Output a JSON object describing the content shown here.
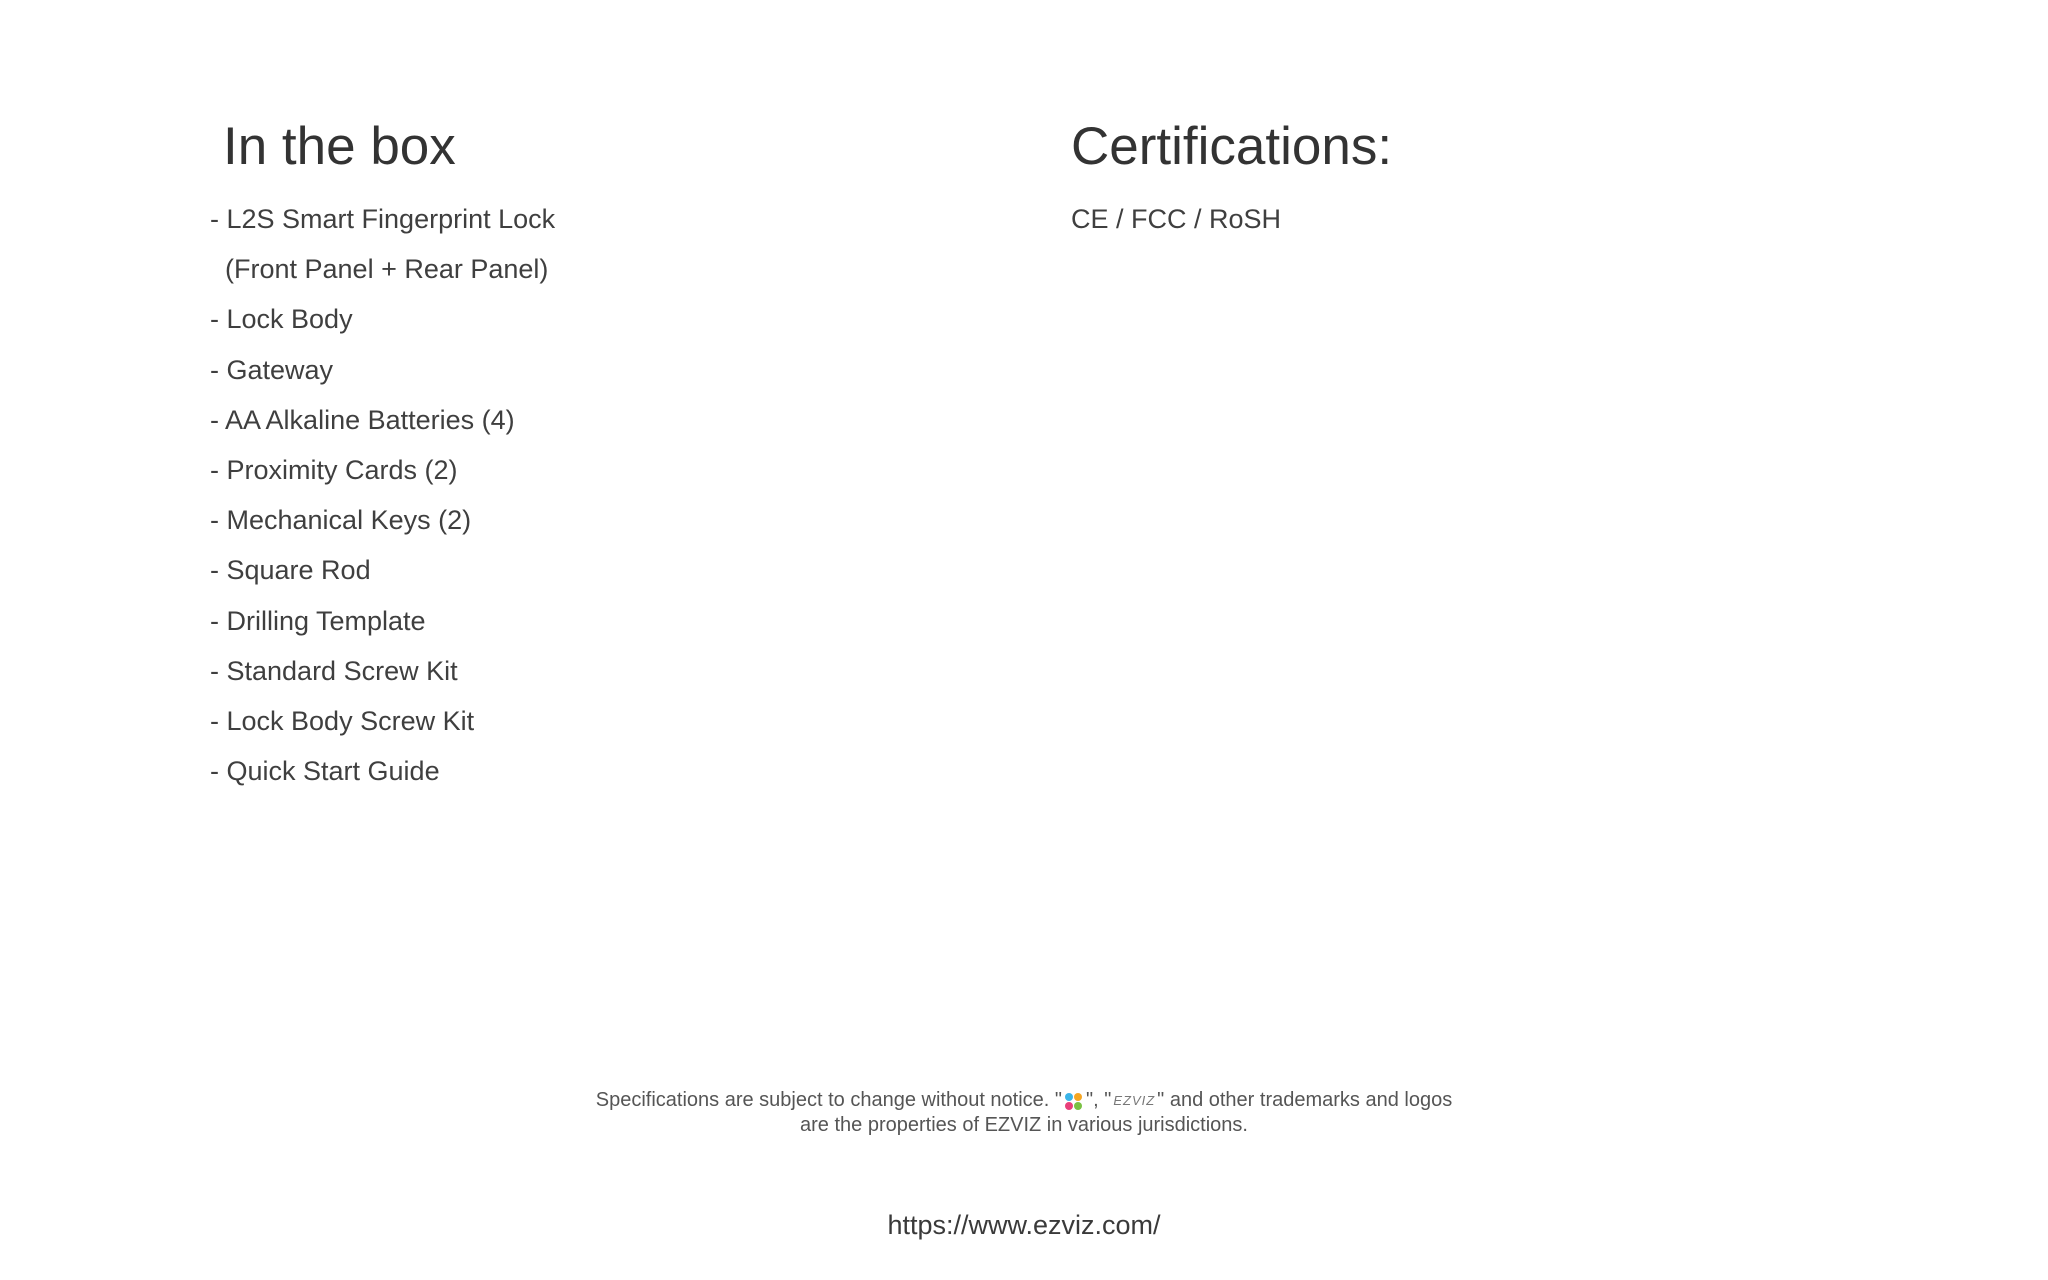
{
  "in_the_box": {
    "heading": "In the box",
    "items": [
      "- L2S Smart Fingerprint Lock",
      "  (Front Panel + Rear Panel)",
      "- Lock Body",
      "- Gateway",
      "- AA Alkaline Batteries (4)",
      "- Proximity Cards (2)",
      "- Mechanical Keys (2)",
      "- Square Rod",
      "- Drilling Template",
      "- Standard Screw Kit",
      "- Lock Body Screw Kit",
      "- Quick Start Guide"
    ]
  },
  "certifications": {
    "heading": "Certifications:",
    "text": "CE / FCC / RoSH"
  },
  "footer": {
    "notice_part1": "Specifications are subject to change without notice.  \"",
    "notice_part2": "\", \"",
    "wordmark": "EZVIZ",
    "notice_part3": "\" and other trademarks and logos",
    "notice_line2": "are the properties of EZVIZ in various jurisdictions.",
    "url": "https://www.ezviz.com/"
  },
  "icons": {
    "logo": "ezviz-logo-icon"
  }
}
